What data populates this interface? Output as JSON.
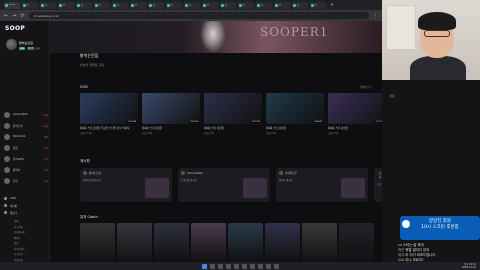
{
  "browser": {
    "tabs": [
      "SOOP",
      "탭",
      "탭",
      "탭",
      "탭",
      "탭",
      "탭",
      "탭",
      "탭",
      "탭",
      "탭",
      "탭",
      "탭",
      "탭",
      "탭",
      "탭",
      "탭",
      "탭"
    ],
    "new_tab": "+",
    "url": "ch.sooplive.co.kr"
  },
  "sidebar": {
    "logo": "SOOP",
    "channel_name": "밝히는던짐",
    "badges": [
      "LIVE",
      "팔로우",
      "···"
    ],
    "favorites": [
      {
        "name": "junsum402",
        "count": "1.2만"
      },
      {
        "name": "칼키스멈",
        "count": "2.1만"
      },
      {
        "name": "Stormc01",
        "count": "8천"
      },
      {
        "name": "풍영",
        "count": "9천"
      },
      {
        "name": "칼키씨Plz",
        "count": "1천"
      },
      {
        "name": "활혁이",
        "count": "5천"
      },
      {
        "name": "현건",
        "count": "3천"
      }
    ],
    "menu": [
      "VOD",
      "게시판",
      "방송국"
    ],
    "submenu": [
      "전체",
      "공지사항",
      "자유게시판",
      "팬아트",
      "클립",
      "하이라이트",
      "다시보기",
      "주요영상",
      "방송국"
    ]
  },
  "main": {
    "banner_text": "SOOPER1",
    "channel_title": "밝히는던짐",
    "channel_sub": "방송국 팬클럽 구독",
    "vod_section": "VOD",
    "posts_section": "게시판",
    "catch_section": "유저 Catch",
    "more": "전체보기 >",
    "vods": [
      {
        "title": "제4회 스타 감정할 무장한 스타일 초보 의사자",
        "meta": "조회수 1.2만",
        "dur": "3:12:04"
      },
      {
        "title": "제4회 스타 감정할",
        "meta": "조회수 8천",
        "dur": "2:54:10"
      },
      {
        "title": "제4회 스타 감정할",
        "meta": "조회수 7천",
        "dur": "4:01:33"
      },
      {
        "title": "제4회 스타 감정할",
        "meta": "조회수 6천",
        "dur": "3:44:20"
      },
      {
        "title": "제4회 스타 감정할",
        "meta": "조회수 5천",
        "dur": "2:11:05"
      }
    ],
    "posts": [
      {
        "author": "밝히는던짐",
        "text": "밝히는던짐 게시글"
      },
      {
        "author": "ChocoDoble",
        "text": "초코더블 게시글"
      },
      {
        "author": "나의팔로우",
        "text": "팔로우 게시글"
      },
      {
        "author": "소니",
        "text": "소니 게시글"
      }
    ]
  },
  "chat": {
    "header": "채팅",
    "donation_line1": "양양친 후원",
    "donation_line2": "10시 스크린 후훈함",
    "lines": [
      {
        "nick": "sa",
        "text": "스티는 잘 봐야",
        "cls": "y"
      },
      {
        "nick": "마인",
        "text": "뭐얼 걸어다 있어",
        "cls": ""
      },
      {
        "nick": "애쉬",
        "text": "아 이거 외모드립니다",
        "cls": "p"
      },
      {
        "nick": "요로",
        "text": "아니 모르지?",
        "cls": ""
      },
      {
        "nick": "abc",
        "text": "다리고원편멍님 오랜만에 가져",
        "cls": "y"
      }
    ]
  },
  "taskbar": {
    "time": "오후 10:12",
    "date": "2024-11-15"
  }
}
